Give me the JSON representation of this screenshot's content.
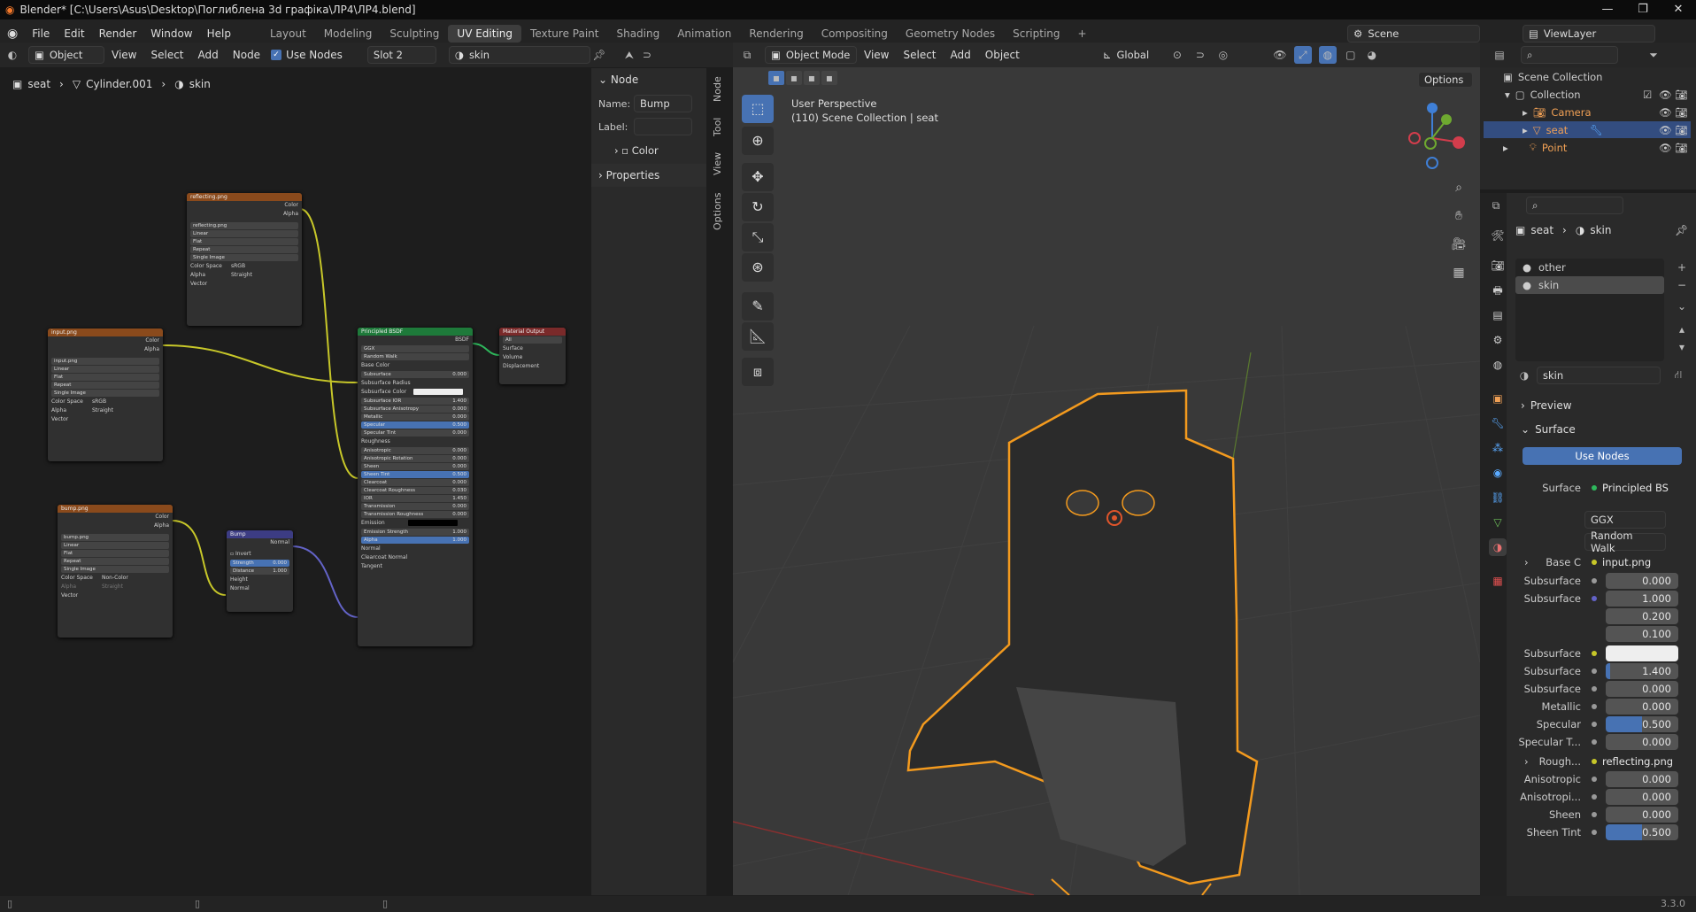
{
  "titlebar": {
    "title": "Blender* [C:\\Users\\Asus\\Desktop\\Поглиблена 3d графіка\\ЛР4\\ЛР4.blend]"
  },
  "menu": {
    "file": "File",
    "edit": "Edit",
    "render": "Render",
    "window": "Window",
    "help": "Help"
  },
  "workspaces": [
    "Layout",
    "Modeling",
    "Sculpting",
    "UV Editing",
    "Texture Paint",
    "Shading",
    "Animation",
    "Rendering",
    "Compositing",
    "Geometry Nodes",
    "Scripting"
  ],
  "scene": {
    "name": "Scene",
    "view_layer": "ViewLayer"
  },
  "node_editor": {
    "mode": "Object",
    "view": "View",
    "select": "Select",
    "add": "Add",
    "node": "Node",
    "use_nodes": "Use Nodes",
    "slot": "Slot 2",
    "material": "skin",
    "breadcrumb": [
      "seat",
      "Cylinder.001",
      "skin"
    ]
  },
  "node_sidebar": {
    "section_node": "Node",
    "name_label": "Name:",
    "name_value": "Bump",
    "label_label": "Label:",
    "color": "Color",
    "properties": "Properties",
    "tabs": [
      "Node",
      "Tool",
      "View",
      "Options"
    ]
  },
  "nodes": {
    "reflecting": {
      "title": "reflecting.png",
      "out_color": "Color",
      "out_alpha": "Alpha",
      "image": "reflecting.png",
      "interp": "Linear",
      "proj": "Flat",
      "ext": "Repeat",
      "src": "Single Image",
      "cs_label": "Color Space",
      "cs": "sRGB",
      "alpha_label": "Alpha",
      "alpha": "Straight",
      "vector": "Vector"
    },
    "input": {
      "title": "input.png",
      "out_color": "Color",
      "out_alpha": "Alpha",
      "image": "input.png",
      "interp": "Linear",
      "proj": "Flat",
      "ext": "Repeat",
      "src": "Single Image",
      "cs_label": "Color Space",
      "cs": "sRGB",
      "alpha_label": "Alpha",
      "alpha": "Straight",
      "vector": "Vector"
    },
    "bump_img": {
      "title": "bump.png",
      "out_color": "Color",
      "out_alpha": "Alpha",
      "image": "bump.png",
      "interp": "Linear",
      "proj": "Flat",
      "ext": "Repeat",
      "src": "Single Image",
      "cs_label": "Color Space",
      "cs": "Non-Color",
      "alpha_label": "Alpha",
      "alpha": "Straight",
      "vector": "Vector"
    },
    "bump": {
      "title": "Bump",
      "out": "Normal",
      "invert": "Invert",
      "strength": "Strength",
      "strength_v": "0.000",
      "distance": "Distance",
      "distance_v": "1.000",
      "height": "Height",
      "normal": "Normal"
    },
    "bsdf": {
      "title": "Principled BSDF",
      "out": "BSDF",
      "dist": "GGX",
      "sss": "Random Walk",
      "rows": [
        [
          "Base Color",
          ""
        ],
        [
          "Subsurface",
          "0.000"
        ],
        [
          "Subsurface Radius",
          ""
        ],
        [
          "Subsurface Color",
          ""
        ],
        [
          "Subsurface IOR",
          "1.400"
        ],
        [
          "Subsurface Anisotropy",
          "0.000"
        ],
        [
          "Metallic",
          "0.000"
        ],
        [
          "Specular",
          "0.500"
        ],
        [
          "Specular Tint",
          "0.000"
        ],
        [
          "Roughness",
          ""
        ],
        [
          "Anisotropic",
          "0.000"
        ],
        [
          "Anisotropic Rotation",
          "0.000"
        ],
        [
          "Sheen",
          "0.000"
        ],
        [
          "Sheen Tint",
          "0.500"
        ],
        [
          "Clearcoat",
          "0.000"
        ],
        [
          "Clearcoat Roughness",
          "0.030"
        ],
        [
          "IOR",
          "1.450"
        ],
        [
          "Transmission",
          "0.000"
        ],
        [
          "Transmission Roughness",
          "0.000"
        ],
        [
          "Emission",
          ""
        ],
        [
          "Emission Strength",
          "1.000"
        ],
        [
          "Alpha",
          "1.000"
        ],
        [
          "Normal",
          ""
        ],
        [
          "Clearcoat Normal",
          ""
        ],
        [
          "Tangent",
          ""
        ]
      ]
    },
    "output": {
      "title": "Material Output",
      "target": "All",
      "surface": "Surface",
      "volume": "Volume",
      "displacement": "Displacement"
    }
  },
  "viewport": {
    "mode": "Object Mode",
    "view": "View",
    "select": "Select",
    "add": "Add",
    "object": "Object",
    "orientation": "Global",
    "options": "Options",
    "persp": "User Perspective",
    "info": "(110) Scene Collection | seat"
  },
  "outliner": {
    "root": "Scene Collection",
    "collection": "Collection",
    "items": [
      "Camera",
      "seat",
      "Point"
    ]
  },
  "properties": {
    "breadcrumb": [
      "seat",
      "skin"
    ],
    "slots": [
      "other",
      "skin"
    ],
    "material": "skin",
    "preview": "Preview",
    "surface": "Surface",
    "use_nodes": "Use Nodes",
    "surface_label": "Surface",
    "surface_val": "Principled BS",
    "dist": "GGX",
    "sss": "Random Walk",
    "rows": [
      {
        "label": "Base C",
        "val": "input.png",
        "type": "link"
      },
      {
        "label": "Subsurface",
        "val": "0.000",
        "type": "num"
      },
      {
        "label": "Subsurface",
        "val": "1.000",
        "type": "num"
      },
      {
        "label": "",
        "val": "0.200",
        "type": "num"
      },
      {
        "label": "",
        "val": "0.100",
        "type": "num"
      },
      {
        "label": "Subsurface",
        "val": "",
        "type": "color"
      },
      {
        "label": "Subsurface",
        "val": "1.400",
        "type": "num"
      },
      {
        "label": "Subsurface",
        "val": "0.000",
        "type": "num"
      },
      {
        "label": "Metallic",
        "val": "0.000",
        "type": "num"
      },
      {
        "label": "Specular",
        "val": "0.500",
        "type": "num"
      },
      {
        "label": "Specular T...",
        "val": "0.000",
        "type": "num"
      },
      {
        "label": "Rough...",
        "val": "reflecting.png",
        "type": "link"
      },
      {
        "label": "Anisotropic",
        "val": "0.000",
        "type": "num"
      },
      {
        "label": "Anisotropi...",
        "val": "0.000",
        "type": "num"
      },
      {
        "label": "Sheen",
        "val": "0.000",
        "type": "num"
      },
      {
        "label": "Sheen Tint",
        "val": "0.500",
        "type": "num"
      }
    ]
  },
  "statusbar": {
    "version": "3.3.0"
  },
  "colors": {
    "accent": "#4772b3",
    "select_orange": "#f39a1e",
    "header": "#262626",
    "bg": "#1d1d1d"
  }
}
